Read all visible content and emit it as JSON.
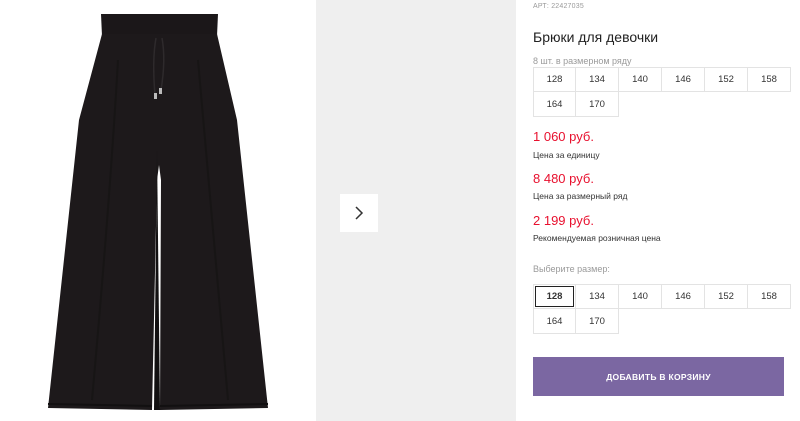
{
  "gallery": {
    "main_image": "black-wide-leg-pants-photo",
    "next_image": "next-photo-placeholder",
    "next_icon": "chevron-right-icon"
  },
  "product": {
    "article": "АРТ: 22427035",
    "title": "Брюки для девочки",
    "size_row_label": "8 шт. в размерном ряду",
    "size_row": [
      "128",
      "134",
      "140",
      "146",
      "152",
      "158",
      "164",
      "170"
    ]
  },
  "prices": {
    "unit_price": "1 060 руб.",
    "unit_caption": "Цена за единицу",
    "row_price": "8 480 руб.",
    "row_caption": "Цена за размерный ряд",
    "retail_price": "2 199 руб.",
    "retail_caption": "Рекомендуемая розничная цена",
    "price_color": "#e8102e"
  },
  "size_select": {
    "label": "Выберите размер:",
    "options": [
      "128",
      "134",
      "140",
      "146",
      "152",
      "158",
      "164",
      "170"
    ],
    "selected": "128"
  },
  "cart": {
    "add_label": "ДОБАВИТЬ В КОРЗИНУ",
    "button_color": "#7b67a2"
  }
}
